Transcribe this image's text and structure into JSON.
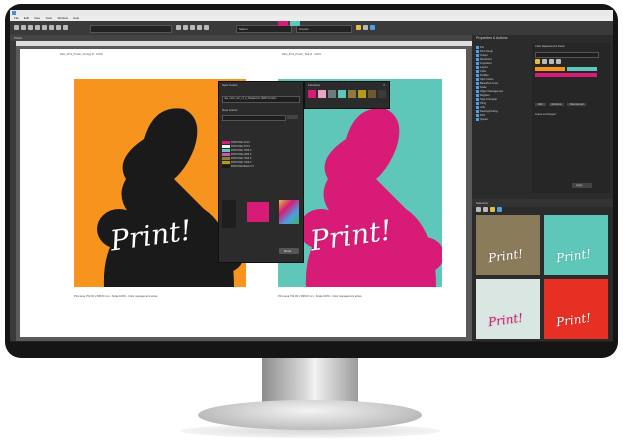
{
  "app": {
    "menu": [
      "File",
      "Edit",
      "View",
      "Tools",
      "Window",
      "Help"
    ],
    "doc_tab": "Print3",
    "toolbar_dropdown_1": "Saturn",
    "toolbar_dropdown_2": "Uranus"
  },
  "poster": {
    "headline": "Print!",
    "left_bg": "#f7941d",
    "right_bg": "#5ec7b9",
    "left_ink": "#1a1a1a",
    "right_ink": "#d81b77"
  },
  "spot_dialog": {
    "title": "Spot Colors",
    "dropdown_value": "rain_color_fan_v1_2_Shaded.icc [SIMT] Colors",
    "new_colors_label": "New Colors",
    "swatch_names": [
      "PANTONE 213 C",
      "PANTONE 375 C",
      "PANTONE 7465 C",
      "PANTONE 2925 C",
      "PANTONE 7544 C",
      "PANTONE 7409 C",
      "PANTONE Black 6 C"
    ],
    "swatch_colors": [
      "#d81b77",
      "#f2f2f2",
      "#5ec7b9",
      "#c85aa5",
      "#8e7b3b",
      "#b59a1a",
      "#1a1a1a"
    ],
    "picked_color": "#d81b77",
    "ok_label": "Done"
  },
  "palette_popup": {
    "title": "Favorites",
    "colors": [
      "#d81b77",
      "#e8a3c7",
      "#6d7c7a",
      "#5ec7b9",
      "#8e7b3b",
      "#b59a1a",
      "#6b5a2d",
      "#3a3a3a"
    ]
  },
  "right_panel": {
    "title": "Properties & Actions",
    "tree_items": [
      "Pos",
      "Print Setup",
      "Output",
      "Resolution",
      "Imposition",
      "Layout",
      "Color",
      "Profiles",
      "Spot Colors",
      "Bleed/Cut Lines",
      "Scale",
      "Object Management",
      "Register",
      "Step & Repeat",
      "Tiling",
      "Jobs",
      "Nesting/Cutting",
      "Print",
      "Queue"
    ],
    "selection_title": "Selection",
    "properties_label": "Color Replacement Panel",
    "replacement_values": [
      "Leave unchanged"
    ],
    "buttons": [
      "Add",
      "Remove",
      "Remove all",
      "Apply"
    ]
  },
  "status": {
    "left_caption": "Print area 762.00 x 508.00 mm - Scale 100% - Color management active",
    "right_caption": "Print area 762.00 x 508.00 mm - Scale 100% - Color management active"
  }
}
